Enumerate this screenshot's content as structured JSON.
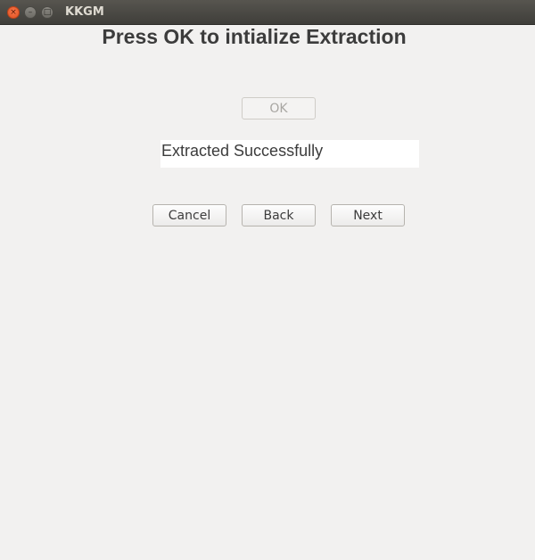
{
  "window": {
    "title": "KKGM",
    "close_glyph": "×",
    "minimize_glyph": "–",
    "maximize_glyph": "□"
  },
  "main": {
    "heading": "Press OK to intialize Extraction",
    "ok_label": "OK",
    "status_text": "Extracted Successfully",
    "cancel_label": "Cancel",
    "back_label": "Back",
    "next_label": "Next"
  },
  "colors": {
    "background": "#f2f1f0",
    "titlebar": "#4a4944",
    "close_button": "#e95420",
    "text": "#3c3c3c"
  }
}
